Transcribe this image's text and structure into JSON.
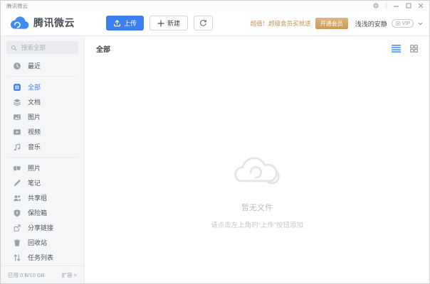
{
  "window": {
    "title": "腾讯微云"
  },
  "header": {
    "logo_text": "腾讯微云",
    "toolbar": {
      "upload_label": "上传",
      "new_label": "新建"
    },
    "promo": {
      "text": "超值！超级会员买就送",
      "button_label": "开通会员"
    },
    "account": {
      "username": "浅浅的安静",
      "vip_label": "VIP"
    }
  },
  "sidebar": {
    "search_placeholder": "搜索全部",
    "items": [
      {
        "key": "recent",
        "icon": "clock-icon",
        "label": "最近",
        "divider_after": true
      },
      {
        "key": "all",
        "icon": "all-files-icon",
        "label": "全部",
        "active": true
      },
      {
        "key": "docs",
        "icon": "layers-icon",
        "label": "文档"
      },
      {
        "key": "pictures",
        "icon": "image-icon",
        "label": "图片"
      },
      {
        "key": "videos",
        "icon": "video-icon",
        "label": "视频"
      },
      {
        "key": "music",
        "icon": "music-icon",
        "label": "音乐",
        "divider_after": true
      },
      {
        "key": "photos",
        "icon": "photos-icon",
        "label": "照片"
      },
      {
        "key": "notes",
        "icon": "pen-icon",
        "label": "笔记"
      },
      {
        "key": "share-group",
        "icon": "people-icon",
        "label": "共享组"
      },
      {
        "key": "safebox",
        "icon": "shield-icon",
        "label": "保险箱"
      },
      {
        "key": "share-links",
        "icon": "share-link-icon",
        "label": "分享链接"
      },
      {
        "key": "recycle-bin",
        "icon": "trash-icon",
        "label": "回收站"
      },
      {
        "key": "task-list",
        "icon": "sort-icon",
        "label": "任务列表"
      }
    ],
    "storage": {
      "used_text": "已用 0 B/10 GB",
      "expand_label": "扩容 >"
    }
  },
  "content": {
    "title": "全部",
    "empty": {
      "title": "暂无文件",
      "hint": "请点击左上角的“上传”按钮添加"
    }
  },
  "colors": {
    "accent_blue": "#3D7EF2",
    "gold_text": "#BF9355",
    "gold_button_start": "#DDB67E",
    "gold_button_end": "#C9995A",
    "sidebar_bg": "#F5F6F7",
    "icon_gray": "#9BA1A9"
  }
}
